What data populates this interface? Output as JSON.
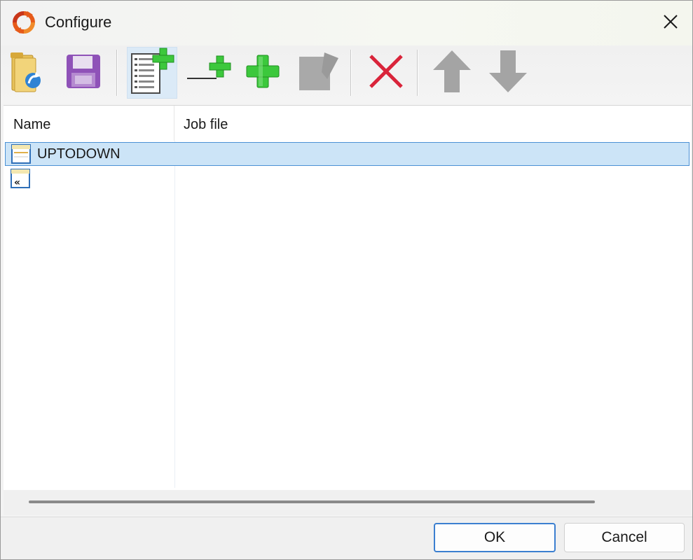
{
  "window": {
    "title": "Configure"
  },
  "toolbar": {
    "buttons": [
      {
        "name": "open-folder-icon",
        "state": "enabled"
      },
      {
        "name": "save-disk-icon",
        "state": "enabled"
      },
      {
        "name": "add-job-file-icon",
        "state": "active"
      },
      {
        "name": "add-separator-icon",
        "state": "enabled"
      },
      {
        "name": "add-icon",
        "state": "enabled"
      },
      {
        "name": "edit-icon",
        "state": "disabled"
      },
      {
        "name": "delete-icon",
        "state": "enabled"
      },
      {
        "name": "move-up-icon",
        "state": "disabled"
      },
      {
        "name": "move-down-icon",
        "state": "disabled"
      }
    ]
  },
  "list": {
    "columns": [
      "Name",
      "Job file"
    ],
    "rows": [
      {
        "name": "UPTODOWN",
        "job_file": "",
        "icon": "folder-list-icon",
        "selected": true
      },
      {
        "name": "",
        "job_file": "",
        "icon": "back-item-icon",
        "selected": false
      }
    ]
  },
  "footer": {
    "ok_label": "OK",
    "cancel_label": "Cancel"
  },
  "colors": {
    "selection": "#cce4f7",
    "selection_border": "#4a90d4",
    "accent": "#3b7fd0",
    "add_green": "#3cc83c",
    "delete_red": "#d9243a"
  }
}
